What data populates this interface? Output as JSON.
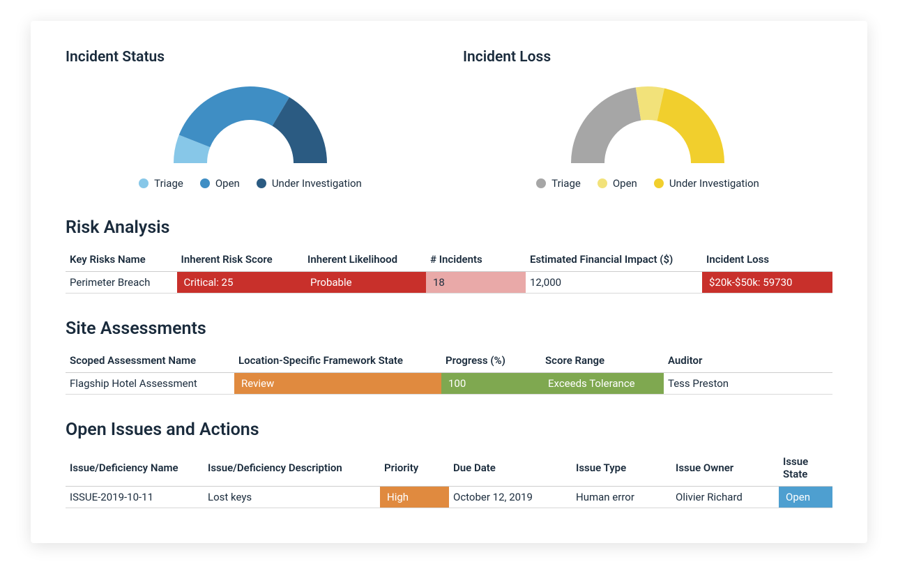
{
  "charts": {
    "status": {
      "title": "Incident Status",
      "legend": [
        {
          "label": "Triage",
          "color": "#87c7e8"
        },
        {
          "label": "Open",
          "color": "#3f8ec4"
        },
        {
          "label": "Under Investigation",
          "color": "#2b5b82"
        }
      ]
    },
    "loss": {
      "title": "Incident Loss",
      "legend": [
        {
          "label": "Triage",
          "color": "#a6a6a6"
        },
        {
          "label": "Open",
          "color": "#f2e27a"
        },
        {
          "label": "Under Investigation",
          "color": "#f1cf2d"
        }
      ]
    }
  },
  "risk": {
    "title": "Risk Analysis",
    "headers": [
      "Key Risks Name",
      "Inherent Risk Score",
      "Inherent Likelihood",
      "# Incidents",
      "Estimated Financial Impact ($)",
      "Incident Loss"
    ],
    "rows": [
      {
        "name": "Perimeter Breach",
        "score": "Critical: 25",
        "likelihood": "Probable",
        "incidents": "18",
        "impact": "12,000",
        "loss": "$20k-$50k: 59730"
      }
    ]
  },
  "assessments": {
    "title": "Site Assessments",
    "headers": [
      "Scoped Assessment Name",
      "Location-Specific Framework State",
      "Progress (%)",
      "Score Range",
      "Auditor"
    ],
    "rows": [
      {
        "name": "Flagship Hotel Assessment",
        "state": "Review",
        "progress": "100",
        "range": "Exceeds Tolerance",
        "auditor": "Tess Preston"
      }
    ]
  },
  "issues": {
    "title": "Open Issues and Actions",
    "headers": [
      "Issue/Deficiency Name",
      "Issue/Deficiency Description",
      "Priority",
      "Due Date",
      "Issue Type",
      "Issue Owner",
      "Issue State"
    ],
    "rows": [
      {
        "name": "ISSUE-2019-10-11",
        "desc": "Lost keys",
        "priority": "High",
        "due": "October 12, 2019",
        "type": "Human error",
        "owner": "Olivier Richard",
        "state": "Open"
      }
    ]
  },
  "chart_data": [
    {
      "type": "pie",
      "title": "Incident Status",
      "series": [
        {
          "name": "Triage",
          "value": 12
        },
        {
          "name": "Open",
          "value": 55
        },
        {
          "name": "Under Investigation",
          "value": 33
        }
      ],
      "style": "half-donut",
      "start_angle_deg": -90,
      "end_angle_deg": 90,
      "colors": [
        "#87c7e8",
        "#3f8ec4",
        "#2b5b82"
      ]
    },
    {
      "type": "pie",
      "title": "Incident Loss",
      "series": [
        {
          "name": "Triage",
          "value": 45
        },
        {
          "name": "Open",
          "value": 12
        },
        {
          "name": "Under Investigation",
          "value": 43
        }
      ],
      "style": "half-donut",
      "start_angle_deg": -90,
      "end_angle_deg": 90,
      "colors": [
        "#a6a6a6",
        "#f2e27a",
        "#f1cf2d"
      ]
    }
  ]
}
